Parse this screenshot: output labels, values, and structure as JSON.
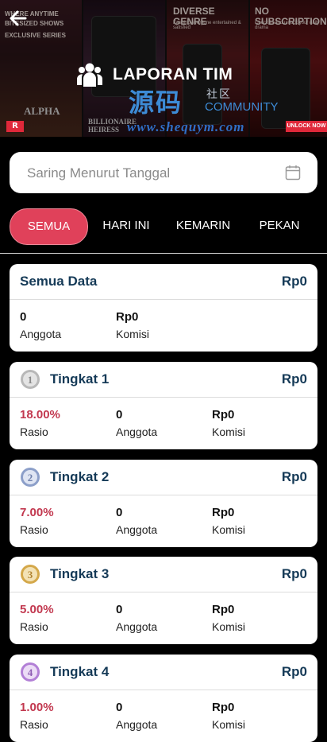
{
  "banner": {
    "panel1_line1": "WHERE ANYTIME",
    "panel1_line2": "BITESIZED SHOWS",
    "panel1_line3": "EXCLUSIVE SERIES",
    "panel1_poster": "ALPHA",
    "panel2_poster": "BILLIONAIRE HEIRESS",
    "panel3_title": "DIVERSE GENRE",
    "panel3_sub": "Keeping everyone entertained & satisfied",
    "panel4_title": "NO SUBSCRIPTION",
    "panel4_sub": "Check in and unlock your daily drama",
    "r_badge": "R",
    "unlock_label": "UNLOCK NOW"
  },
  "header": {
    "title": "LAPORAN TIM",
    "back_icon": "arrow-left-icon",
    "title_icon": "team-icon"
  },
  "watermark": {
    "cn_main": "源码",
    "cn_side": "社区",
    "en": "COMMUNITY",
    "url": "www.shequym.com"
  },
  "filter": {
    "placeholder": "Saring Menurut Tanggal",
    "icon": "calendar-icon"
  },
  "tabs": [
    {
      "label": "SEMUA",
      "active": true
    },
    {
      "label": "HARI INI",
      "active": false
    },
    {
      "label": "KEMARIN",
      "active": false
    },
    {
      "label": "PEKAN",
      "active": false
    }
  ],
  "summary": {
    "title": "Semua Data",
    "amount": "Rp0",
    "members_value": "0",
    "members_label": "Anggota",
    "commission_value": "Rp0",
    "commission_label": "Komisi"
  },
  "levels": [
    {
      "title": "Tingkat 1",
      "amount": "Rp0",
      "ratio": "18.00%",
      "ratio_label": "Rasio",
      "members": "0",
      "members_label": "Anggota",
      "commission": "Rp0",
      "commission_label": "Komisi",
      "medal_icon": "medal-1-icon",
      "medal_color": "#9a9a9a"
    },
    {
      "title": "Tingkat 2",
      "amount": "Rp0",
      "ratio": "7.00%",
      "ratio_label": "Rasio",
      "members": "0",
      "members_label": "Anggota",
      "commission": "Rp0",
      "commission_label": "Komisi",
      "medal_icon": "medal-2-icon",
      "medal_color": "#8c9fc9"
    },
    {
      "title": "Tingkat 3",
      "amount": "Rp0",
      "ratio": "5.00%",
      "ratio_label": "Rasio",
      "members": "0",
      "members_label": "Anggota",
      "commission": "Rp0",
      "commission_label": "Komisi",
      "medal_icon": "medal-3-icon",
      "medal_color": "#d4a84a"
    },
    {
      "title": "Tingkat 4",
      "amount": "Rp0",
      "ratio": "1.00%",
      "ratio_label": "Rasio",
      "members": "0",
      "members_label": "Anggota",
      "commission": "Rp0",
      "commission_label": "Komisi",
      "medal_icon": "medal-4-icon",
      "medal_color": "#b27fd6"
    }
  ],
  "colors": {
    "accent": "#e0415a",
    "title_text": "#153a57",
    "ratio_text": "#c2384f"
  }
}
